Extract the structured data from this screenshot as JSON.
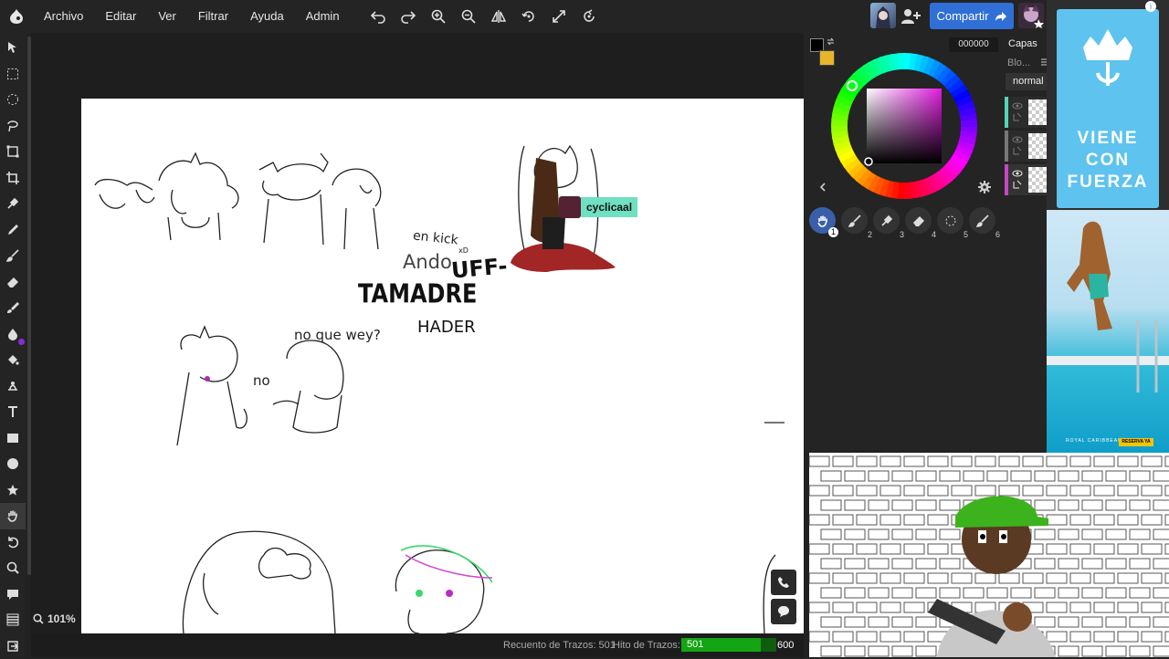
{
  "menu": [
    "Archivo",
    "Editar",
    "Ver",
    "Filtrar",
    "Ayuda",
    "Admin"
  ],
  "toolbar_icons": [
    "undo-icon",
    "redo-icon",
    "zoom-in-icon",
    "zoom-out-icon",
    "flip-icon",
    "rotate-icon",
    "fullscreen-icon",
    "settings-rotate-icon"
  ],
  "share": {
    "label": "Compartir"
  },
  "left_tools": [
    "move",
    "rect-select",
    "ellipse-select",
    "lasso",
    "transform",
    "crop",
    "eyedropper",
    "pencil",
    "brush",
    "eraser",
    "smudge",
    "blur",
    "fill",
    "dodge",
    "text",
    "rectangle",
    "ellipse",
    "star",
    "hand",
    "undo-history",
    "zoom",
    "chat",
    "layers",
    "export"
  ],
  "canvas_text": {
    "kick": "en kick",
    "xd": "xD",
    "ando": "Ando",
    "uff": "UFF-",
    "tamadre": "TAMADRE",
    "hader": "HADER",
    "noquewey": "no que wey?",
    "no": "no"
  },
  "cursor_user": "cyclicaal",
  "zoom": "101%",
  "status": {
    "count_label": "Recuento de Trazos: 501",
    "hit_label": "Hito de Trazos:",
    "current": "501",
    "max": "600",
    "progress_fraction": 0.835
  },
  "color": {
    "hex": "000000",
    "fg": "#000000",
    "bg": "#e8b52a"
  },
  "layers": {
    "title": "Capas",
    "blend_label": "Blo...",
    "mode": "normal",
    "items": [
      {
        "strip": "#54d6b4"
      },
      {
        "strip": "#777777"
      },
      {
        "strip": "#c646c6"
      }
    ]
  },
  "brushes": [
    "1",
    "2",
    "3",
    "4",
    "5",
    "6"
  ],
  "ad": {
    "headline": "VIENE CON FUERZA",
    "brand": "ROYAL CARIBBEAN",
    "cta": "RESERVA YA",
    "info": "i"
  }
}
